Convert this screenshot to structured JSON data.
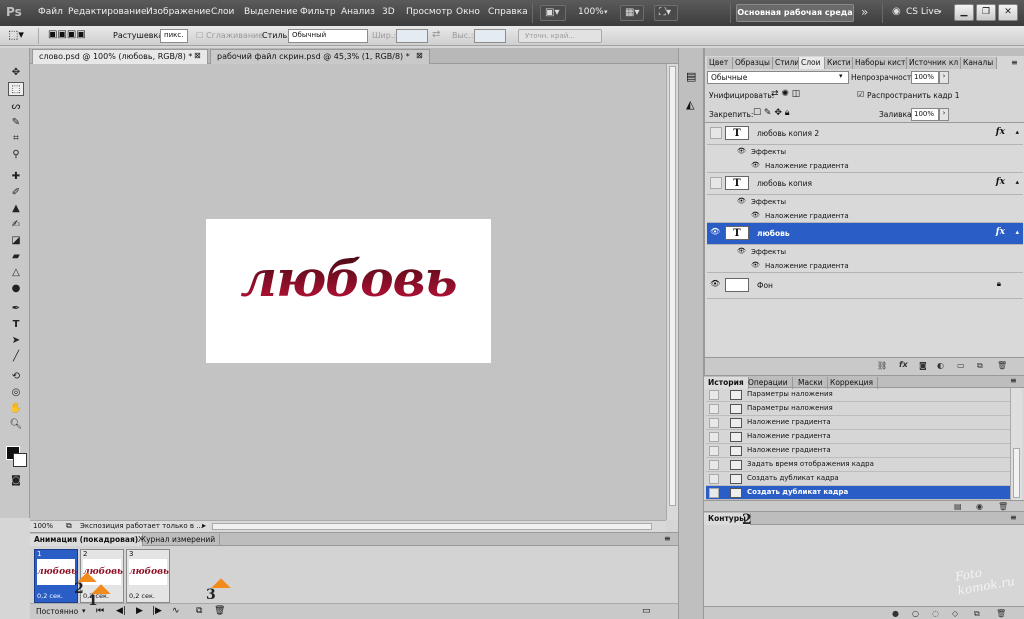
{
  "app": {
    "logo": "Ps",
    "menu": [
      "Файл",
      "Редактирование",
      "Изображение",
      "Слои",
      "Выделение",
      "Фильтр",
      "Анализ",
      "3D",
      "Просмотр",
      "Окно",
      "Справка"
    ],
    "zoom": "100%",
    "workspace": "Основная рабочая среда",
    "cslive": "CS Live"
  },
  "options": {
    "feather_label": "Растушевка:",
    "feather_value": "пикс.",
    "antialias": "Сглаживание",
    "style_label": "Стиль:",
    "style_value": "Обычный",
    "width_label": "Шир.:",
    "height_label": "Выс.:",
    "refine": "Уточн. край..."
  },
  "tabs": [
    {
      "label": "слово.psd @ 100% (любовь, RGB/8) *",
      "active": true
    },
    {
      "label": "рабочий файл скрин.psd @ 45,3% (1, RGB/8) *",
      "active": false
    }
  ],
  "canvas": {
    "word": "любовь"
  },
  "status": {
    "zoom": "100%",
    "text": "Экспозиция работает только в ..."
  },
  "animation": {
    "tab_active": "Анимация (покадровая)",
    "tab_other": "Журнал измерений",
    "frames": [
      {
        "num": "1",
        "thumb": "любовь",
        "duration": "0,2 сек.",
        "selected": true
      },
      {
        "num": "2",
        "thumb": "любовь",
        "duration": "0,2 сек.",
        "selected": false
      },
      {
        "num": "3",
        "thumb": "любовь",
        "duration": "0,2 сек.",
        "selected": false
      }
    ],
    "loop": "Постоянно",
    "markers": [
      "2",
      "1",
      "3"
    ]
  },
  "layers_panel": {
    "tabs": [
      "Цвет",
      "Образцы",
      "Стили",
      "Слои",
      "Кисти",
      "Наборы кистей",
      "Источник кл",
      "Каналы"
    ],
    "active_tab": "Слои",
    "blend_mode": "Обычные",
    "opacity_label": "Непрозрачность:",
    "opacity_value": "100%",
    "unify_label": "Унифицировать:",
    "propagate_label": "Распространить кадр 1",
    "lock_label": "Закрепить:",
    "fill_label": "Заливка:",
    "fill_value": "100%",
    "effects_label": "Эффекты",
    "effect_name": "Наложение градиента",
    "layers": [
      {
        "name": "любовь копия 2",
        "type": "T",
        "visible": false,
        "selected": false
      },
      {
        "name": "любовь копия",
        "type": "T",
        "visible": false,
        "selected": false
      },
      {
        "name": "любовь",
        "type": "T",
        "visible": true,
        "selected": true
      },
      {
        "name": "Фон",
        "type": "",
        "visible": true,
        "selected": false
      }
    ]
  },
  "history_panel": {
    "tabs": [
      "История",
      "Операции",
      "Маски",
      "Коррекция"
    ],
    "active_tab": "История",
    "items": [
      "Параметры наложения",
      "Параметры наложения",
      "Наложение градиента",
      "Наложение градиента",
      "Наложение градиента",
      "Задать время отображения кадра",
      "Создать дубликат кадра",
      "Создать дубликат кадра"
    ],
    "selected_index": 7
  },
  "paths_panel": {
    "tab": "Контуры",
    "marker": "2"
  },
  "watermark": "Foto komok.ru",
  "colors": {
    "accent": "#2a5ec6",
    "word_top": "#3a0a10",
    "word_bottom": "#c4123a"
  }
}
